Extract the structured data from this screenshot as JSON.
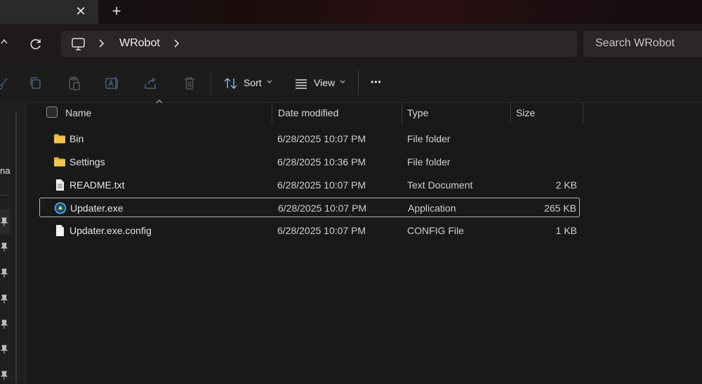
{
  "tabs": {
    "new_tab": "+",
    "close": "✕"
  },
  "address": {
    "crumb": "WRobot"
  },
  "search": {
    "placeholder": "Search WRobot"
  },
  "commands": {
    "sort_label": "Sort",
    "view_label": "View",
    "more_label": "•••"
  },
  "left_pane": {
    "partial_label": "na"
  },
  "columns": {
    "name": "Name",
    "date": "Date modified",
    "type": "Type",
    "size": "Size"
  },
  "files": [
    {
      "name": "Bin",
      "date": "6/28/2025 10:07 PM",
      "type": "File folder",
      "size": "",
      "icon": "folder-icon"
    },
    {
      "name": "Settings",
      "date": "6/28/2025 10:36 PM",
      "type": "File folder",
      "size": "",
      "icon": "folder-icon"
    },
    {
      "name": "README.txt",
      "date": "6/28/2025 10:07 PM",
      "type": "Text Document",
      "size": "2 KB",
      "icon": "text-file-icon"
    },
    {
      "name": "Updater.exe",
      "date": "6/28/2025 10:07 PM",
      "type": "Application",
      "size": "265 KB",
      "icon": "application-icon",
      "selected": true
    },
    {
      "name": "Updater.exe.config",
      "date": "6/28/2025 10:07 PM",
      "type": "CONFIG File",
      "size": "1 KB",
      "icon": "config-file-icon"
    }
  ],
  "colors": {
    "accent_folder": "#f5c451",
    "selection_border": "#b5b5b5",
    "background": "#191919"
  }
}
